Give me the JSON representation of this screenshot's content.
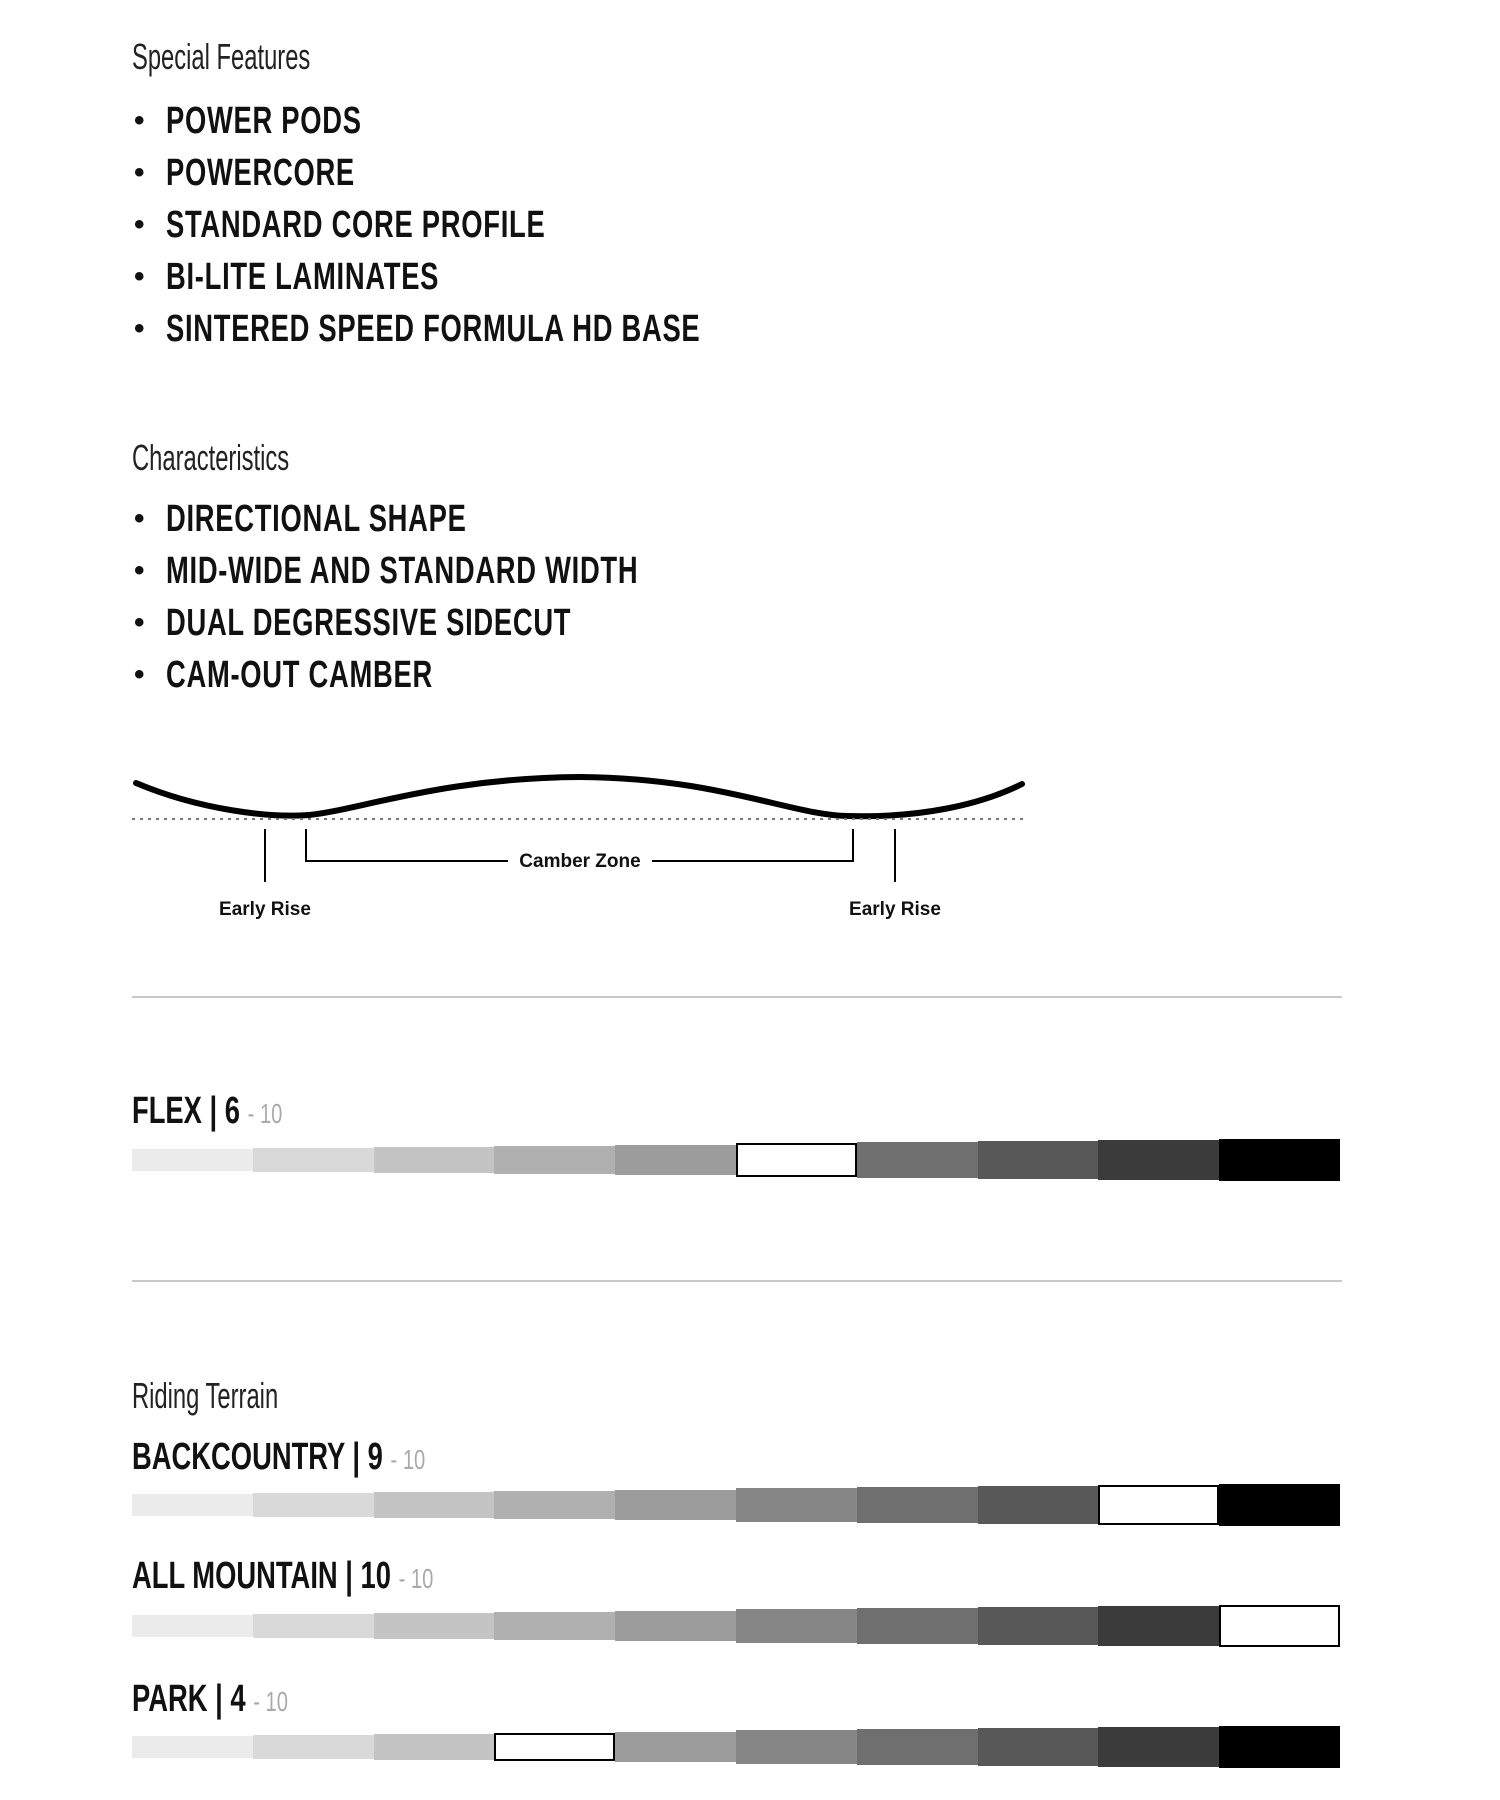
{
  "special_features": {
    "heading": "Special Features",
    "items": [
      "POWER PODS",
      "POWERCORE",
      "STANDARD CORE PROFILE",
      "BI-LITE LAMINATES",
      "SINTERED SPEED FORMULA HD BASE"
    ]
  },
  "characteristics": {
    "heading": "Characteristics",
    "items": [
      "DIRECTIONAL SHAPE",
      "MID-WIDE AND STANDARD WIDTH",
      "DUAL DEGRESSIVE SIDECUT",
      "CAM-OUT CAMBER"
    ]
  },
  "camber_diagram": {
    "left_label": "Early Rise",
    "center_label": "Camber Zone",
    "right_label": "Early Rise"
  },
  "flex": {
    "label": "FLEX",
    "separator": "|",
    "value": 6,
    "max_text": "- 10",
    "max": 10
  },
  "riding_terrain": {
    "heading": "Riding Terrain",
    "ratings": [
      {
        "label": "BACKCOUNTRY",
        "separator": "|",
        "value": 9,
        "max_text": "- 10",
        "max": 10
      },
      {
        "label": "ALL MOUNTAIN",
        "separator": "|",
        "value": 10,
        "max_text": "- 10",
        "max": 10
      },
      {
        "label": "PARK",
        "separator": "|",
        "value": 4,
        "max_text": "- 10",
        "max": 10
      }
    ]
  },
  "scale_colors": [
    "#ebebeb",
    "#d9d9d9",
    "#c4c4c4",
    "#b0b0b0",
    "#9c9c9c",
    "#868686",
    "#6f6f6f",
    "#585858",
    "#3b3b3b",
    "#000000"
  ],
  "selected_color": "#ffffff"
}
